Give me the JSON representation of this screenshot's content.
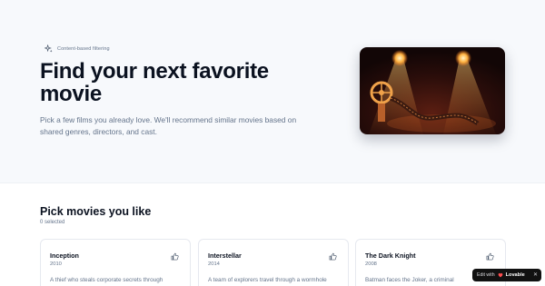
{
  "hero": {
    "tagline": "Content-based filtering",
    "title": "Find your next favorite movie",
    "subtitle": "Pick a few films you already love. We'll recommend similar movies based on shared genres, directors, and cast.",
    "image_icon": "film-projector-spotlight-image"
  },
  "picker": {
    "title": "Pick movies you like",
    "selected_count": "0 selected",
    "movies": [
      {
        "title": "Inception",
        "year": "2010",
        "description": "A thief who steals corporate secrets through",
        "icon": "thumbs-up-icon"
      },
      {
        "title": "Interstellar",
        "year": "2014",
        "description": "A team of explorers travel through a wormhole",
        "icon": "thumbs-up-icon"
      },
      {
        "title": "The Dark Knight",
        "year": "2008",
        "description": "Batman faces the Joker, a criminal",
        "icon": "thumbs-up-icon"
      }
    ]
  },
  "badge": {
    "edit_label": "Edit with",
    "brand": "Lovable",
    "close": "✕"
  },
  "colors": {
    "background_hero": "#f7f9fc",
    "text_primary": "#0b1220",
    "text_muted": "#64748b",
    "brand_heart": "#ff4d4f"
  }
}
